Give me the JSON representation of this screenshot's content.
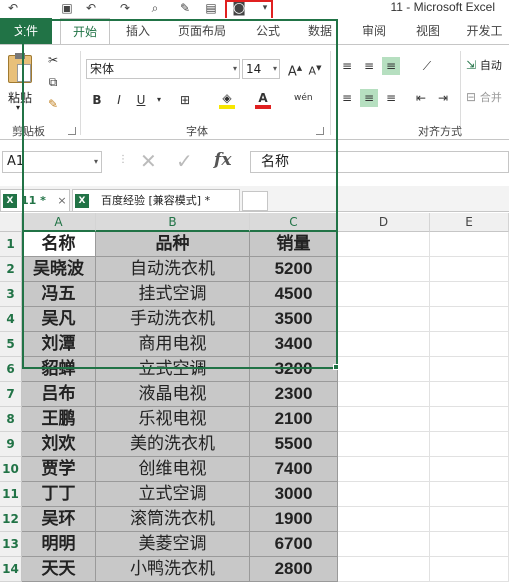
{
  "window_title": "11 - Microsoft Excel",
  "ribbon_tabs": [
    "文件",
    "开始",
    "插入",
    "页面布局",
    "公式",
    "数据",
    "审阅",
    "视图",
    "开发工"
  ],
  "ribbon": {
    "clipboard": {
      "paste_label": "粘贴",
      "group_label": "剪贴板"
    },
    "font": {
      "font_name": "宋体",
      "font_size": "14",
      "group_label": "字体",
      "bold": "B",
      "italic": "I",
      "underline": "U"
    },
    "alignment": {
      "group_label": "对齐方式",
      "wrap_label": "自动",
      "merge_label": "合并"
    }
  },
  "formula_bar": {
    "name_box": "A1",
    "fx": "fx",
    "formula": "名称"
  },
  "workbook_tabs": [
    {
      "label": "11 *",
      "close": "×"
    },
    {
      "label": "百度经验 [兼容模式] *"
    }
  ],
  "columns": [
    "A",
    "B",
    "C",
    "D",
    "E"
  ],
  "rows": [
    "1",
    "2",
    "3",
    "4",
    "5",
    "6",
    "7",
    "8",
    "9",
    "10",
    "11",
    "12",
    "13",
    "14"
  ],
  "table": {
    "headers": [
      "名称",
      "品种",
      "销量"
    ],
    "data": [
      [
        "吴晓波",
        "自动洗衣机",
        "5200"
      ],
      [
        "冯五",
        "挂式空调",
        "4500"
      ],
      [
        "吴凡",
        "手动洗衣机",
        "3500"
      ],
      [
        "刘潭",
        "商用电视",
        "3400"
      ],
      [
        "貂蝉",
        "立式空调",
        "3200"
      ],
      [
        "吕布",
        "液晶电视",
        "2300"
      ],
      [
        "王鹏",
        "乐视电视",
        "2100"
      ],
      [
        "刘欢",
        "美的洗衣机",
        "5500"
      ],
      [
        "贾学",
        "创维电视",
        "7400"
      ],
      [
        "丁丁",
        "立式空调",
        "3000"
      ],
      [
        "吴环",
        "滚筒洗衣机",
        "1900"
      ],
      [
        "明明",
        "美菱空调",
        "6700"
      ],
      [
        "天天",
        "小鸭洗衣机",
        "2800"
      ]
    ]
  },
  "colors": {
    "excel_green": "#217346",
    "cell_gray": "#c8c8c8",
    "highlight_red": "#e02020"
  }
}
